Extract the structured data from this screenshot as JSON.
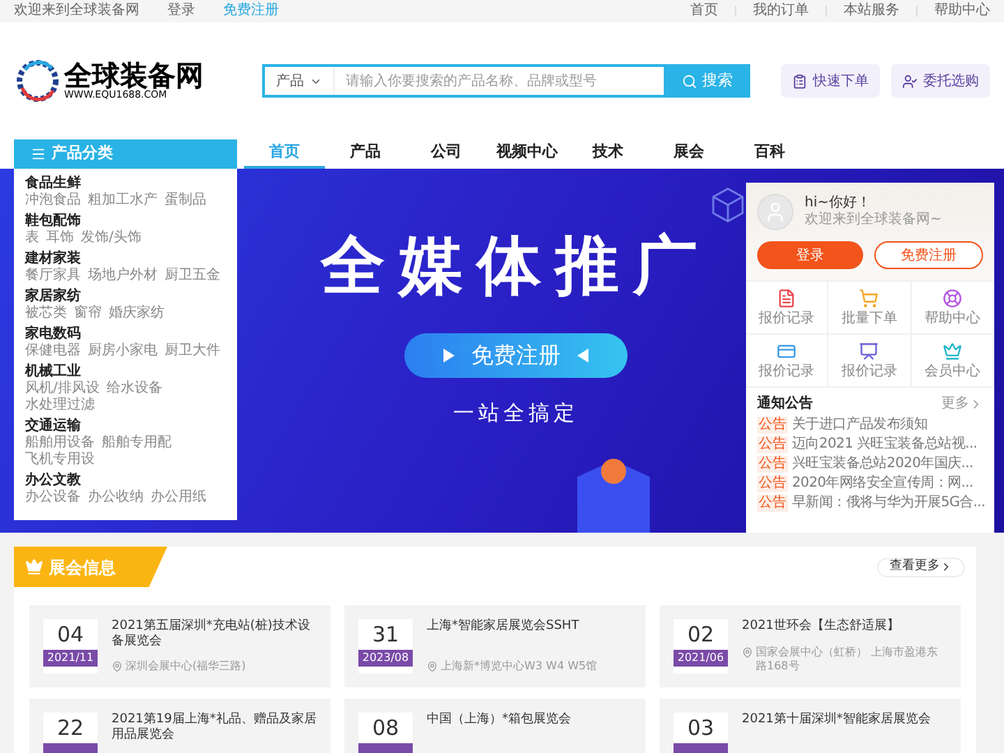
{
  "top_bar": {
    "welcome": "欢迎来到全球装备网",
    "links": [
      {
        "label": "登录",
        "highlighted": false
      },
      {
        "label": "免费注册",
        "highlighted": true
      }
    ],
    "right_links": [
      "首页",
      "我的订单",
      "本站服务",
      "帮助中心"
    ]
  },
  "logo": {
    "name": "全球装备网",
    "url": "WWW.EQU1688.COM"
  },
  "search": {
    "category": "产品",
    "placeholder": "请输入你要搜索的产品名称、品牌或型号",
    "button": "搜索"
  },
  "header_buttons": [
    "快速下单",
    "委托选购"
  ],
  "category_menu": {
    "title": "产品分类",
    "groups": [
      {
        "title": "食品生鲜",
        "items": [
          "冲泡食品",
          "粗加工水产",
          "蛋制品"
        ]
      },
      {
        "title": "鞋包配饰",
        "items": [
          "表",
          "耳饰",
          "发饰/头饰"
        ]
      },
      {
        "title": "建材家装",
        "items": [
          "餐厅家具",
          "场地户外材",
          "厨卫五金"
        ]
      },
      {
        "title": "家居家纺",
        "items": [
          "被芯类",
          "窗帘",
          "婚庆家纺"
        ]
      },
      {
        "title": "家电数码",
        "items": [
          "保健电器",
          "厨房小家电",
          "厨卫大件"
        ]
      },
      {
        "title": "机械工业",
        "items": [
          "风机/排风设",
          "给水设备",
          "水处理过滤"
        ]
      },
      {
        "title": "交通运输",
        "items": [
          "船舶用设备",
          "船舶专用配",
          "飞机专用设"
        ]
      },
      {
        "title": "办公文教",
        "items": [
          "办公设备",
          "办公收纳",
          "办公用纸"
        ]
      }
    ]
  },
  "nav": {
    "items": [
      {
        "label": "首页",
        "selected": true
      },
      {
        "label": "产品",
        "selected": false
      },
      {
        "label": "公司",
        "selected": false
      },
      {
        "label": "视频中心",
        "selected": false
      },
      {
        "label": "技术",
        "selected": false
      },
      {
        "label": "展会",
        "selected": false
      },
      {
        "label": "百科",
        "selected": false
      }
    ]
  },
  "banner": {
    "headline": "全媒体推广",
    "button": "免费注册",
    "tagline": "一站全搞定"
  },
  "user_card": {
    "greeting": "hi~你好！",
    "welcome": "欢迎来到全球装备网~",
    "login": "登录",
    "register": "免费注册",
    "shortcuts": [
      "报价记录",
      "批量下单",
      "帮助中心",
      "报价记录",
      "报价记录",
      "会员中心"
    ],
    "notices_title": "通知公告",
    "more": "更多",
    "notices": [
      {
        "tag": "公告",
        "text": "关于进口产品发布须知"
      },
      {
        "tag": "公告",
        "text": "迈向2021 兴旺宝装备总站视..."
      },
      {
        "tag": "公告",
        "text": "兴旺宝装备总站2020年国庆..."
      },
      {
        "tag": "公告",
        "text": "2020年网络安全宣传周：网..."
      },
      {
        "tag": "公告",
        "text": "早新闻：俄将与华为开展5G合..."
      }
    ]
  },
  "exhibitions": {
    "title": "展会信息",
    "more": "查看更多",
    "items": [
      {
        "day": "04",
        "month": "2021/11",
        "title": "2021第五届深圳*充电站(桩)技术设备展览会",
        "location": "深圳会展中心(福华三路)"
      },
      {
        "day": "31",
        "month": "2023/08",
        "title": "上海*智能家居展览会SSHT",
        "location": "上海新*博览中心W3 W4 W5馆"
      },
      {
        "day": "02",
        "month": "2021/06",
        "title": "2021世环会【生态舒适展】",
        "location": "国家会展中心（虹桥） 上海市盈港东路168号"
      },
      {
        "day": "22",
        "title": "2021第19届上海*礼品、赠品及家居用品展览会"
      },
      {
        "day": "08",
        "title": "中国（上海）*箱包展览会"
      },
      {
        "day": "03",
        "title": "2021第十届深圳*智能家居展览会"
      }
    ]
  }
}
